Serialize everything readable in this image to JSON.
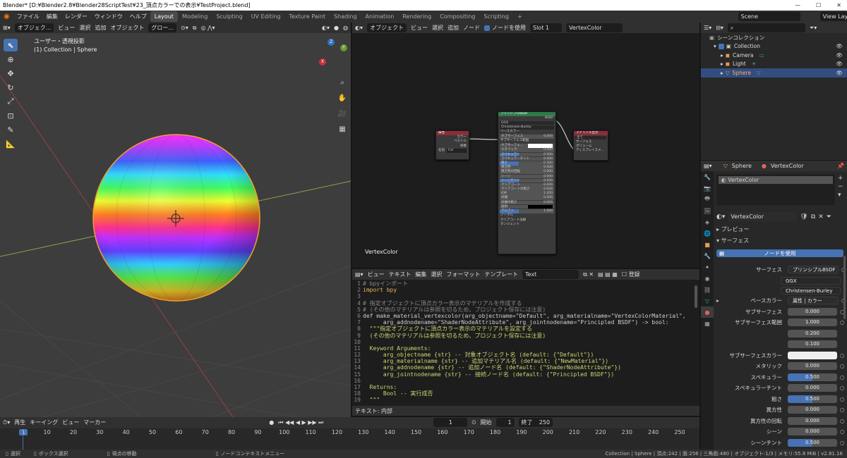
{
  "window": {
    "title": "Blender* [D:¥Blender2.8¥Blender28ScriptTest¥23_頂点カラーでの表示¥TestProject.blend]",
    "controls": [
      "—",
      "☐",
      "✕"
    ]
  },
  "menu": [
    "ファイル",
    "編集",
    "レンダー",
    "ウィンドウ",
    "ヘルプ"
  ],
  "workspaces": [
    "Layout",
    "Modeling",
    "Sculpting",
    "UV Editing",
    "Texture Paint",
    "Shading",
    "Animation",
    "Rendering",
    "Compositing",
    "Scripting",
    "+"
  ],
  "active_workspace": "Layout",
  "scene": "Scene",
  "view_layer": "View Layer",
  "viewport": {
    "header": [
      "オブジェク...",
      "ビュー",
      "選択",
      "追加",
      "オブジェクト",
      "グロー..."
    ],
    "mode_label": "ユーザー・透視投影",
    "collection_label": "(1) Collection | Sphere",
    "gizmo": [
      "Z",
      "Y",
      "X"
    ]
  },
  "node_editor": {
    "header": [
      "オブジェクト",
      "ビュー",
      "選択",
      "追加",
      "ノード"
    ],
    "use_nodes": "ノードを使用",
    "slot": "Slot 1",
    "material": "VertexColor",
    "label": "VertexColor",
    "attr_node": {
      "title": "属性",
      "outputs": [
        "カラー",
        "ベクトル",
        "係数"
      ],
      "name_label": "名前",
      "name": "Col"
    },
    "bsdf_node": {
      "title": "プリンシプルBSDF",
      "out": "BSDF",
      "dist": "GGX",
      "sss": "Christensen-Burley",
      "rows": [
        [
          "ベースカラー",
          ""
        ],
        [
          "サブサーフェス",
          "0.000"
        ],
        [
          "サブサーフェス範囲",
          ""
        ],
        [
          "サブサーフェ...",
          ""
        ],
        [
          "メタリック",
          "0.000"
        ],
        [
          "スペキュラー",
          "0.500"
        ],
        [
          "スペキュラーチント",
          "0.000"
        ],
        [
          "粗さ",
          "0.500"
        ],
        [
          "異方性",
          "0.000"
        ],
        [
          "異方性の回転",
          "0.000"
        ],
        [
          "シーン",
          "0.000"
        ],
        [
          "シーンチント",
          "0.500"
        ],
        [
          "クリアコート",
          "0.000"
        ],
        [
          "クリアコートの粗さ",
          "0.030"
        ],
        [
          "IOR",
          "1.450"
        ],
        [
          "伝播",
          "0.000"
        ],
        [
          "伝播の粗さ",
          "0.000"
        ],
        [
          "放射",
          ""
        ],
        [
          "アルファ",
          "1.000"
        ],
        [
          "ノーマル",
          ""
        ],
        [
          "クリアコート法線",
          ""
        ],
        [
          "タンジェント",
          ""
        ]
      ]
    },
    "out_node": {
      "title": "マテリアル出力",
      "target": "全て",
      "inputs": [
        "サーフェス",
        "ボリューム",
        "ディスプレイスメ..."
      ]
    }
  },
  "text_editor": {
    "header": [
      "ビュー",
      "テキスト",
      "編集",
      "選択",
      "フォーマット",
      "テンプレート"
    ],
    "name": "Text",
    "register": "登録",
    "footer": "テキスト: 内部",
    "lines": [
      {
        "n": "1",
        "t": "# bpyインポート",
        "c": "cm"
      },
      {
        "n": "2",
        "t": "import bpy",
        "c": "kw"
      },
      {
        "n": "3",
        "t": "",
        "c": ""
      },
      {
        "n": "4",
        "t": "# 指定オブジェクトに頂点カラー表示のマテリアルを作成する",
        "c": "cm"
      },
      {
        "n": "5",
        "t": "# (その他のマテリアルは参照を切るため、プロジェクト保存には注意)",
        "c": "cm"
      },
      {
        "n": "6",
        "t": "def make_material_vertexcolor(arg_objectname=\"Default\", arg_materialname=\"VertexColorMaterial\",",
        "c": "fn"
      },
      {
        "n": "7",
        "t": "      arg_addnodename=\"ShaderNodeAttribute\", arg_jointnodename=\"Principled BSDF\") -> bool:",
        "c": "fn"
      },
      {
        "n": "8",
        "t": "  \"\"\"指定オブジェクトに頂点カラー表示のマテリアルを設定する",
        "c": "st"
      },
      {
        "n": "9",
        "t": "  (その他のマテリアルは参照を切るため、プロジェクト保存には注意)",
        "c": "st"
      },
      {
        "n": "10",
        "t": "",
        "c": ""
      },
      {
        "n": "11",
        "t": "  Keyword Arguments:",
        "c": "st"
      },
      {
        "n": "12",
        "t": "      arg_objectname {str} -- 対象オブジェクト名 (default: {\"Default\"})",
        "c": "st"
      },
      {
        "n": "13",
        "t": "      arg_materialname {str} -- 追加マテリアル名 (default: {\"NewMaterial\"})",
        "c": "st"
      },
      {
        "n": "14",
        "t": "      arg_addnodename {str} -- 追加ノード名 (default: {\"ShaderNodeAttribute\"})",
        "c": "st"
      },
      {
        "n": "15",
        "t": "      arg_jointnodename {str} -- 接続ノード名 (default: {\"Principled BSDF\"})",
        "c": "st"
      },
      {
        "n": "16",
        "t": "",
        "c": ""
      },
      {
        "n": "17",
        "t": "  Returns:",
        "c": "st"
      },
      {
        "n": "18",
        "t": "      Bool -- 実行成否",
        "c": "st"
      },
      {
        "n": "19",
        "t": "  \"\"\"",
        "c": "st"
      }
    ]
  },
  "timeline": {
    "header": [
      "再生",
      "キーイング",
      "ビュー",
      "マーカー"
    ],
    "current": "1",
    "start_label": "開始",
    "start": "1",
    "end_label": "終了",
    "end": "250",
    "ticks": [
      "1",
      "10",
      "20",
      "30",
      "40",
      "50",
      "60",
      "70",
      "80",
      "90",
      "100",
      "110",
      "120",
      "130",
      "140",
      "150",
      "160",
      "170",
      "180",
      "190",
      "200",
      "210",
      "220",
      "230",
      "240",
      "250"
    ]
  },
  "status_bar": {
    "left": [
      "選択",
      "ボックス選択",
      "視点の移動",
      "ノードコンテキストメニュー"
    ],
    "right": "Collection | Sphere | 頂点:242 | 面:256 | 三角面:480 | オブジェクト:1/3 | メモリ:55.8 MiB | v2.81.16"
  },
  "outliner": {
    "root": "シーンコレクション",
    "items": [
      {
        "name": "Collection",
        "indent": 1
      },
      {
        "name": "Camera",
        "indent": 2
      },
      {
        "name": "Light",
        "indent": 2
      },
      {
        "name": "Sphere",
        "indent": 2,
        "selected": true
      }
    ]
  },
  "properties": {
    "object": "Sphere",
    "material": "VertexColor",
    "slot_item": "VertexColor",
    "mat_field": "VertexColor",
    "preview": "プレビュー",
    "surface_panel": "サーフェス",
    "use_nodes": "ノードを使用",
    "surface_label": "サーフェス",
    "surface_val": "プリンシプルBSDF",
    "dist": "GGX",
    "sss": "Christensen-Burley",
    "base_color_label": "ベースカラー",
    "base_color_val": "属性 | カラー",
    "rows": [
      [
        "サブサーフェス",
        "0.000",
        ""
      ],
      [
        "サブサーフェス範囲",
        "1.000",
        ""
      ],
      [
        "",
        "0.200",
        ""
      ],
      [
        "",
        "0.100",
        ""
      ],
      [
        "サブサーフェスカラー",
        "",
        "white"
      ],
      [
        "メタリック",
        "0.000",
        ""
      ],
      [
        "スペキュラー",
        "0.500",
        "blue"
      ],
      [
        "スペキュラーチント",
        "0.000",
        ""
      ],
      [
        "粗さ",
        "0.500",
        "blue"
      ],
      [
        "異方性",
        "0.000",
        ""
      ],
      [
        "異方性の回転",
        "0.000",
        ""
      ],
      [
        "シーン",
        "0.000",
        ""
      ],
      [
        "シーンチント",
        "0.500",
        "blue"
      ]
    ]
  }
}
